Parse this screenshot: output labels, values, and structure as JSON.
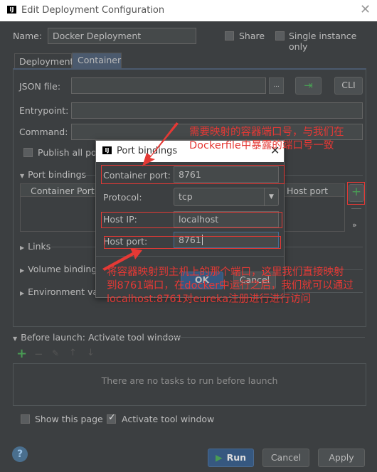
{
  "window": {
    "title": "Edit Deployment Configuration"
  },
  "name": {
    "label": "Name:",
    "value": "Docker Deployment"
  },
  "share": {
    "label": "Share",
    "checked": false
  },
  "single_instance": {
    "label": "Single instance only",
    "checked": false
  },
  "tabs": [
    {
      "label": "Deployment",
      "active": false
    },
    {
      "label": "Container",
      "active": true
    }
  ],
  "container": {
    "json_file_label": "JSON file:",
    "json_file_value": "",
    "browse_label": "...",
    "cli_label": "CLI",
    "entrypoint_label": "Entrypoint:",
    "command_label": "Command:",
    "publish_all_label": "Publish all ports",
    "port_bindings_label": "Port bindings",
    "table_headers": [
      "Container Port",
      "Host port"
    ],
    "more_label": "»",
    "links_label": "Links",
    "volume_label": "Volume bindings",
    "env_label": "Environment variables"
  },
  "dialog": {
    "title": "Port bindings",
    "container_port_label": "Container port:",
    "container_port_value": "8761",
    "protocol_label": "Protocol:",
    "protocol_value": "tcp",
    "host_ip_label": "Host IP:",
    "host_ip_value": "localhost",
    "host_port_label": "Host port:",
    "host_port_value": "8761",
    "ok_label": "OK",
    "cancel_label": "Cancel"
  },
  "annotations": {
    "top": [
      "需要映射的容器端口号，与我们在",
      "Dockerfile中暴露的端口号一致"
    ],
    "bottom": [
      "将容器映射到主机上的那个端口，这里我们直接映射",
      "到8761端口，在docker中运行之后，我们就可以通过",
      "localhost:8761对eureka注册进行进行访问"
    ],
    "color": "#e53935"
  },
  "before_launch": {
    "label": "Before launch: Activate tool window",
    "empty_text": "There are no tasks to run before launch"
  },
  "show_page": {
    "label": "Show this page",
    "checked": false
  },
  "activate_tool": {
    "label": "Activate tool window",
    "checked": true
  },
  "footer": {
    "run_label": "Run",
    "cancel_label": "Cancel",
    "apply_label": "Apply"
  },
  "colors": {
    "background": "#3c3f41",
    "accent_green": "#499c54",
    "primary_button": "#365880"
  }
}
